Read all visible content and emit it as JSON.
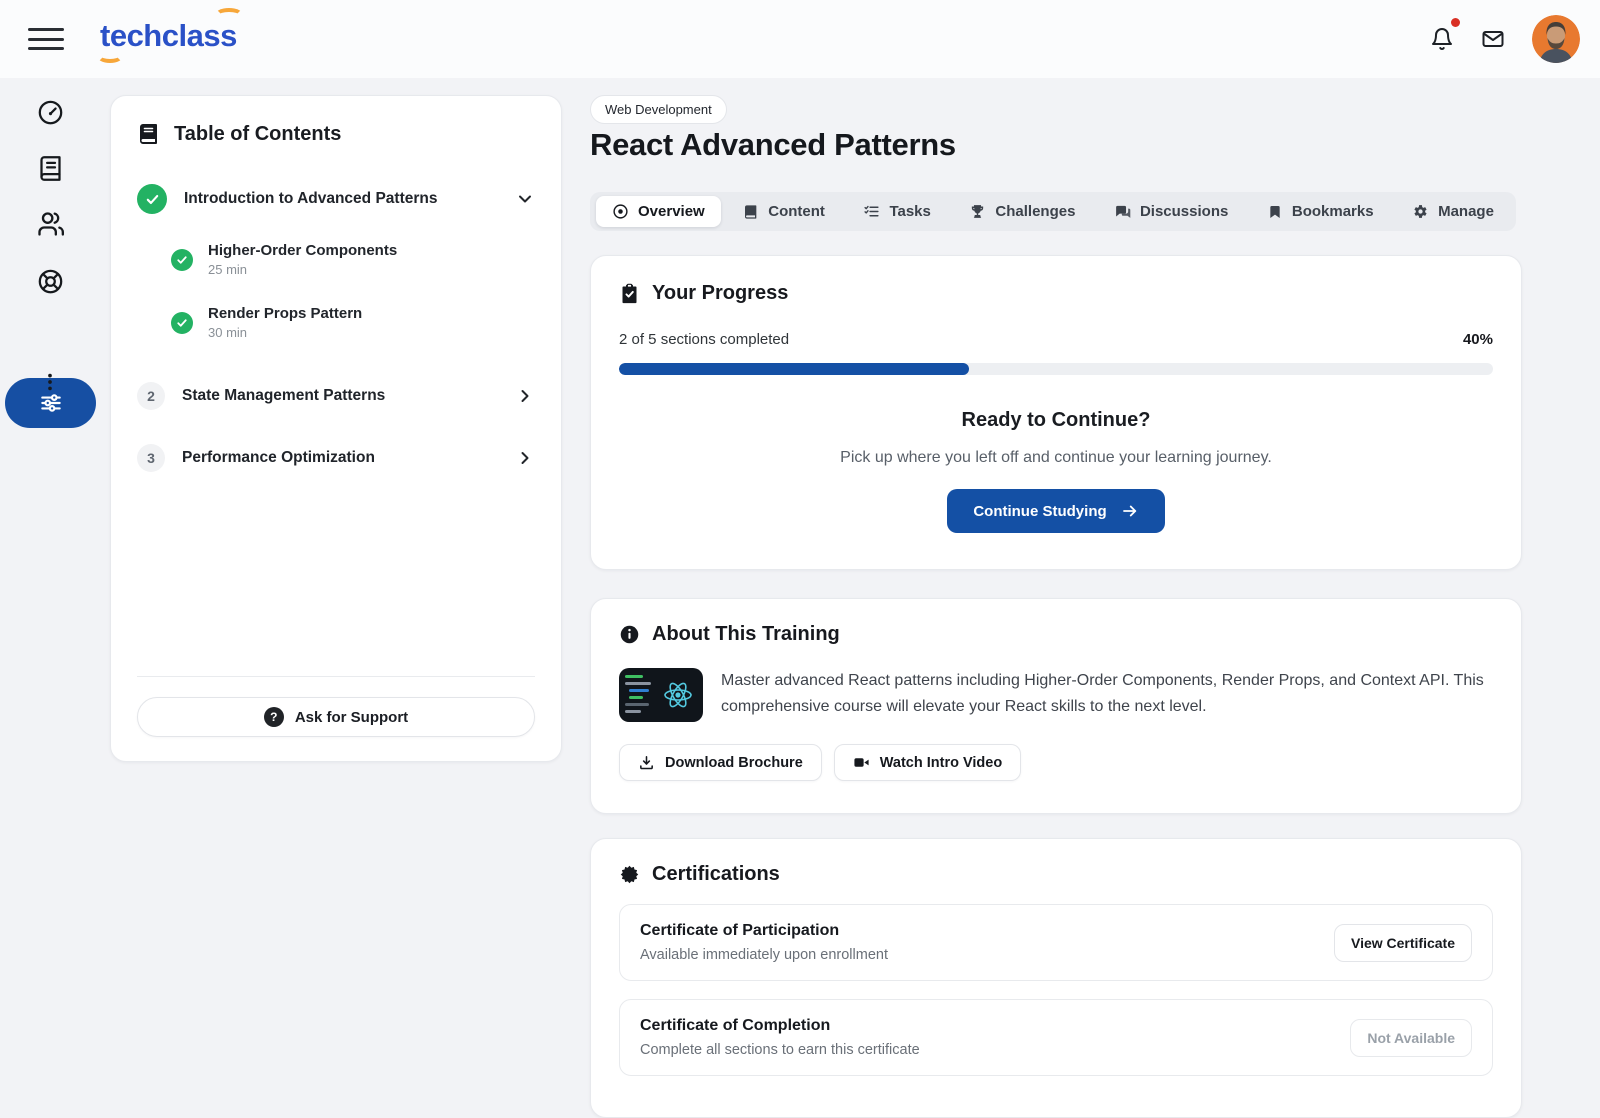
{
  "header": {
    "logo_text": "techclass",
    "icons": {
      "menu": "hamburger-icon",
      "notifications": "bell-icon",
      "messages": "mail-icon",
      "profile": "avatar"
    },
    "notification_unread": true
  },
  "sidebar": {
    "items": [
      {
        "icon": "dashboard-gauge-icon",
        "active": false
      },
      {
        "icon": "book-icon",
        "active": false
      },
      {
        "icon": "users-icon",
        "active": false
      },
      {
        "icon": "help-lifering-icon",
        "active": false
      },
      {
        "icon": "sliders-icon",
        "active": true
      },
      {
        "icon": "more-dots-icon",
        "active": false
      }
    ]
  },
  "toc": {
    "title": "Table of Contents",
    "items": [
      {
        "label": "Introduction to Advanced Patterns",
        "status": "completed",
        "expanded": true,
        "children": [
          {
            "title": "Higher-Order Components",
            "duration": "25 min",
            "status": "completed"
          },
          {
            "title": "Render Props Pattern",
            "duration": "30 min",
            "status": "completed"
          }
        ]
      },
      {
        "number": "2",
        "label": "State Management Patterns",
        "expanded": false
      },
      {
        "number": "3",
        "label": "Performance Optimization",
        "expanded": false
      }
    ],
    "support_label": "Ask for Support"
  },
  "course": {
    "category": "Web Development",
    "title": "React Advanced Patterns",
    "tabs": [
      {
        "label": "Overview",
        "icon": "eye-icon",
        "active": true
      },
      {
        "label": "Content",
        "icon": "book-icon",
        "active": false
      },
      {
        "label": "Tasks",
        "icon": "task-list-icon",
        "active": false
      },
      {
        "label": "Challenges",
        "icon": "trophy-icon",
        "active": false
      },
      {
        "label": "Discussions",
        "icon": "chat-bubbles-icon",
        "active": false
      },
      {
        "label": "Bookmarks",
        "icon": "bookmark-icon",
        "active": false
      },
      {
        "label": "Manage",
        "icon": "gear-icon",
        "active": false
      }
    ]
  },
  "progress": {
    "title": "Your Progress",
    "sections_text": "2 of 5 sections completed",
    "percent": 40,
    "percent_label": "40%",
    "ready_title": "Ready to Continue?",
    "ready_text": "Pick up where you left off and continue your learning journey.",
    "cta_label": "Continue Studying"
  },
  "about": {
    "title": "About This Training",
    "description": "Master advanced React patterns including Higher-Order Components, Render Props, and Context API. This comprehensive course will elevate your React skills to the next level.",
    "download_label": "Download Brochure",
    "video_label": "Watch Intro Video"
  },
  "certifications": {
    "title": "Certifications",
    "items": [
      {
        "title": "Certificate of Participation",
        "subtitle": "Available immediately upon enrollment",
        "action": "View Certificate",
        "enabled": true
      },
      {
        "title": "Certificate of Completion",
        "subtitle": "Complete all sections to earn this certificate",
        "action": "Not Available",
        "enabled": false
      }
    ]
  },
  "colors": {
    "accent_blue": "#1450a5",
    "logo_blue": "#2a51c7",
    "logo_orange": "#f7a73a",
    "success_green": "#23b263",
    "alert_red": "#d93025",
    "page_bg": "#f2f3f6"
  }
}
